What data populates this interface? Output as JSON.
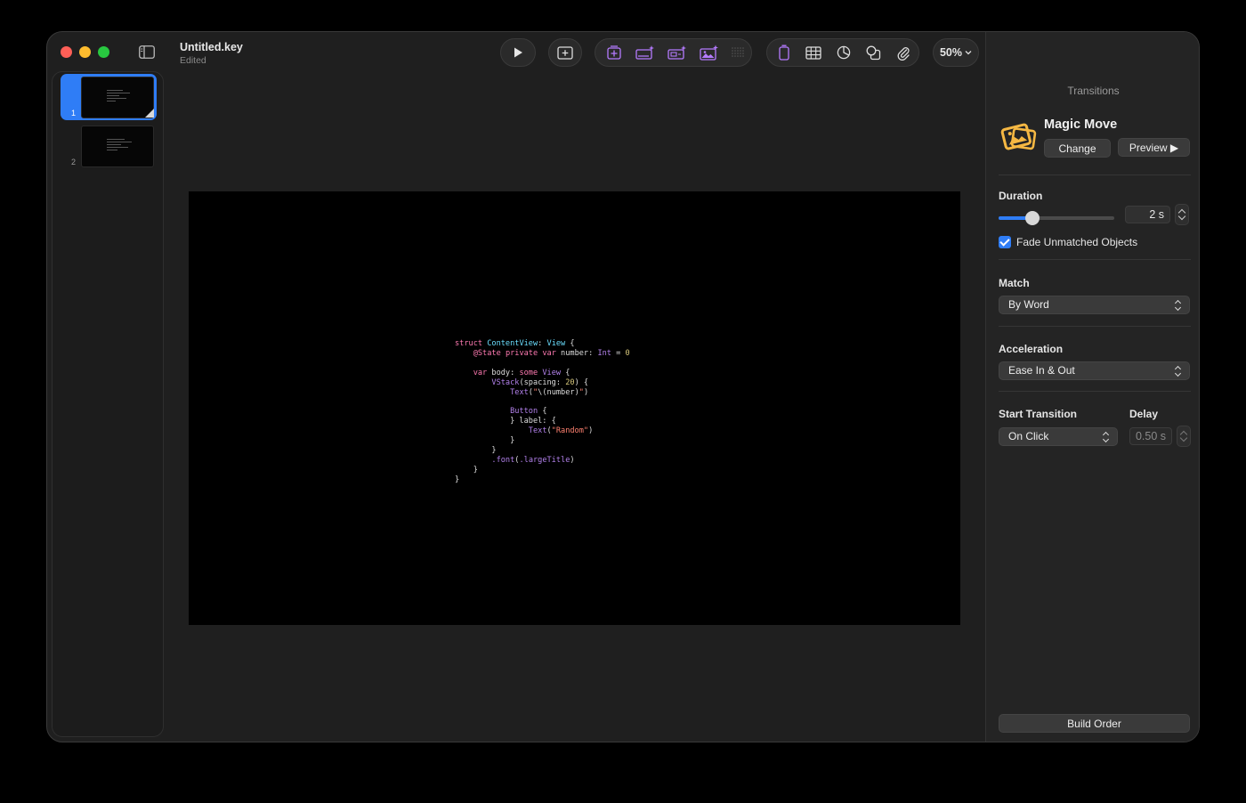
{
  "window": {
    "title": "Untitled.key",
    "subtitle": "Edited"
  },
  "toolbar": {
    "zoom": "50%"
  },
  "navigator": {
    "slides": [
      {
        "number": "1",
        "selected": true
      },
      {
        "number": "2",
        "selected": false
      }
    ]
  },
  "slide_code": {
    "lines": [
      "struct ContentView: View {",
      "    @State private var number: Int = 0",
      "",
      "    var body: some View {",
      "        VStack(spacing: 20) {",
      "            Text(\"\\(number)\")",
      "",
      "            Button {",
      "            } label: {",
      "                Text(\"Random\")",
      "            }",
      "        }",
      "        .font(.largeTitle)",
      "    }",
      "}"
    ]
  },
  "inspector": {
    "header": "Transitions",
    "transition_name": "Magic Move",
    "change_label": "Change",
    "preview_label": "Preview ▶",
    "duration_label": "Duration",
    "duration_value": "2 s",
    "duration_fraction": 0.29,
    "fade_label": "Fade Unmatched Objects",
    "fade_checked": true,
    "match_label": "Match",
    "match_value": "By Word",
    "acceleration_label": "Acceleration",
    "acceleration_value": "Ease In & Out",
    "start_label": "Start Transition",
    "start_value": "On Click",
    "delay_label": "Delay",
    "delay_value": "0.50 s",
    "build_order_label": "Build Order"
  },
  "colors": {
    "accent": "#2f7df6",
    "magic_move_icon": "#f5b843",
    "toolbar_insert_purple": "#b57bff"
  }
}
